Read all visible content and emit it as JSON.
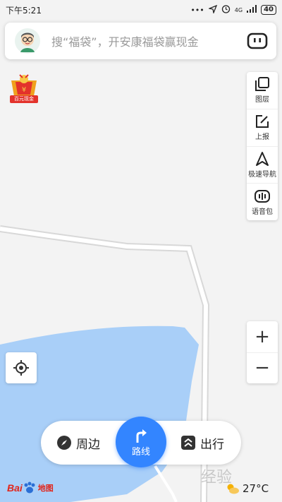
{
  "status_bar": {
    "time": "下午5:21",
    "network": "4G",
    "battery": "40"
  },
  "search": {
    "placeholder": "搜“福袋”，开安康福袋赢现金"
  },
  "promo": {
    "label": "百元现金"
  },
  "right_panel": {
    "items": [
      {
        "label": "图层",
        "icon": "layers-icon"
      },
      {
        "label": "上报",
        "icon": "report-icon"
      },
      {
        "label": "极速导航",
        "icon": "navigation-icon"
      },
      {
        "label": "语音包",
        "icon": "voice-pack-icon"
      }
    ]
  },
  "zoom": {
    "in": "+",
    "out": "−"
  },
  "bottom_bar": {
    "nearby_label": "周边",
    "route_label": "路线",
    "travel_label": "出行"
  },
  "logo": {
    "bai": "Bai",
    "map": "地图"
  },
  "weather": {
    "temperature": "27°C"
  },
  "watermark": "经验",
  "colors": {
    "accent": "#3385ff",
    "water": "#a9cff8",
    "road": "#ffffff",
    "land": "#f3f3f3"
  }
}
